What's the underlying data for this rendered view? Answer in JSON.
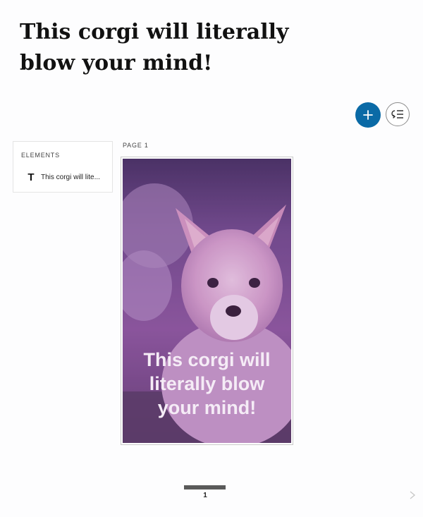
{
  "story": {
    "title": "This corgi will literally blow your mind!"
  },
  "toolbar": {
    "add_icon": "plus-icon",
    "reorder_icon": "reorder-list-icon",
    "accent_color": "#0a6aa6"
  },
  "elements_panel": {
    "heading": "ELEMENTS",
    "items": [
      {
        "icon": "text-T-icon",
        "type_glyph": "T",
        "label": "This corgi will lite..."
      }
    ]
  },
  "page": {
    "label": "PAGE 1",
    "text": "This corgi will literally blow your mind!",
    "overlay_color": "#8a3fa6"
  },
  "carousel": {
    "page_number": "1",
    "next_icon": "chevron-right-icon"
  }
}
